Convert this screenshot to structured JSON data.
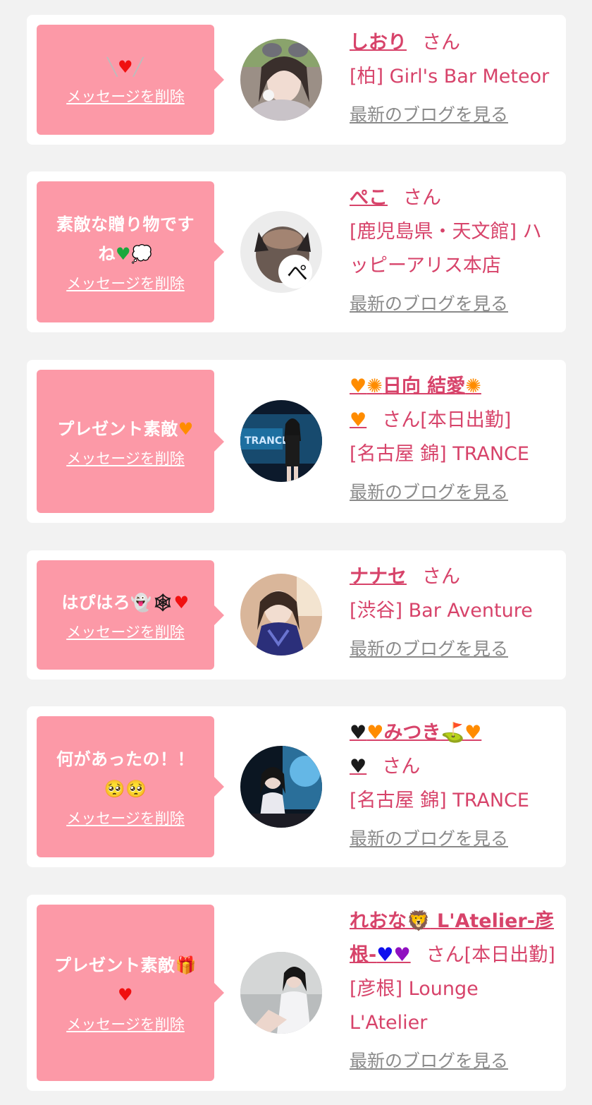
{
  "colors": {
    "background": "#f2f2f2",
    "card": "#ffffff",
    "bubble": "#fc99a7",
    "name_pink": "#d7436a",
    "link_gray": "#8a8a8a"
  },
  "labels": {
    "delete_message": "メッセージを削除",
    "latest_blog": "最新のブログを見る",
    "san": "さん",
    "san_on_duty": "さん[本日出勤]"
  },
  "messages": [
    {
      "message_parts": [
        "╲",
        "♥",
        "╱"
      ],
      "icons": [
        "sparkle-lines-icon",
        "red-heart-icon"
      ],
      "name_parts": [
        "しおり"
      ],
      "honorific": "さん",
      "shop": "[柏] Girl's Bar Meteor"
    },
    {
      "message_parts": [
        "素敵な贈り物です",
        "ね",
        "♥",
        "💭"
      ],
      "icons": [
        "green-heart-icon",
        "thought-bubble-icon"
      ],
      "name_parts": [
        "ぺこ"
      ],
      "honorific": "さん",
      "shop": "[鹿児島県・天文館] ハッピーアリス本店"
    },
    {
      "message_parts": [
        "プレゼント素敵",
        "♥"
      ],
      "icons": [
        "orange-heart-icon"
      ],
      "name_parts": [
        "♥",
        "✺",
        "日向 結愛",
        "✺",
        "♥"
      ],
      "honorific": "さん[本日出勤]",
      "shop": "[名古屋 錦] TRANCE"
    },
    {
      "message_parts": [
        "はぴはろ",
        "👻",
        "🕸",
        "♥"
      ],
      "icons": [
        "ghost-icon",
        "spider-web-icon",
        "red-heart-icon"
      ],
      "name_parts": [
        "ナナセ"
      ],
      "honorific": "さん",
      "shop": "[渋谷] Bar Aventure"
    },
    {
      "message_parts": [
        "何があったの！！",
        "🥺🥺"
      ],
      "icons": [
        "pleading-face-icon",
        "pleading-face-icon"
      ],
      "name_parts": [
        "♥",
        "♥",
        "みつき",
        "⛳",
        "♥",
        "♥"
      ],
      "honorific": "さん",
      "shop": "[名古屋 錦] TRANCE"
    },
    {
      "message_parts": [
        "プレゼント素敵",
        "🎁",
        "♥"
      ],
      "icons": [
        "gift-icon",
        "red-heart-icon"
      ],
      "name_parts": [
        "れおな",
        "🦁",
        " L'Atelier-彦根-",
        "♥",
        "♥"
      ],
      "honorific": "さん[本日出勤]",
      "shop": "[彦根] Lounge L'Atelier"
    }
  ]
}
